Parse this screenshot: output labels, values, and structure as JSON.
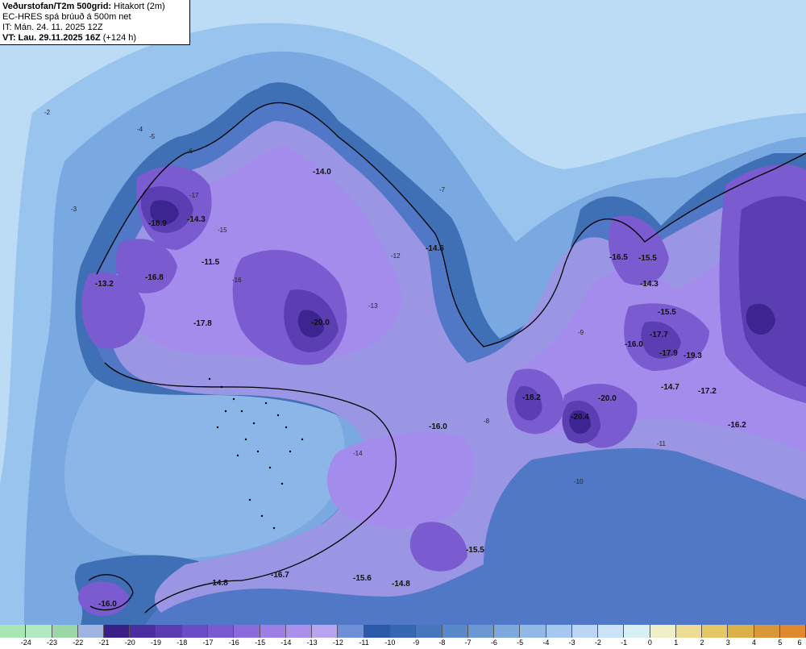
{
  "header": {
    "title": "Veðurstofan/T2m 500grid:",
    "subtitle": "Hitakort (2m)",
    "model_line": "EC-HRES spá brúuð á 500m net",
    "init_time": "IT: Mán. 24. 11. 2025 12Z",
    "valid_time": "VT: Lau. 29.11.2025 16Z",
    "lead": "(+124 h)"
  },
  "colors": {
    "sea_far": "#bcdcf6",
    "sea_mid": "#98c4ee",
    "sea_near": "#7aa8e0",
    "coast_band": "#3f6fb4",
    "coast_dark": "#2a4f8e",
    "land_m10": "#5078c6",
    "land_m12": "#8e96de",
    "land_m14": "#a48cec",
    "land_m16": "#7a5cd0",
    "land_m18": "#5a3eb2",
    "land_m20": "#3c2590"
  },
  "scale": {
    "labels": [
      "-24",
      "-23",
      "-22",
      "-21",
      "-20",
      "-19",
      "-18",
      "-17",
      "-16",
      "-15",
      "-14",
      "-13",
      "-12",
      "-11",
      "-10",
      "-9",
      "-8",
      "-7",
      "-6",
      "-5",
      "-4",
      "-3",
      "-2",
      "-1",
      "0",
      "1",
      "2",
      "3",
      "4",
      "5",
      "6"
    ],
    "colors": [
      "#a8e6b4",
      "#b2e8c2",
      "#9ad6a6",
      "#9fb4e0",
      "#3a1f86",
      "#4c2ea0",
      "#5a3cb0",
      "#6a4cc4",
      "#7a5ad0",
      "#8c6adc",
      "#9c7ee4",
      "#aa90ea",
      "#b8a4f0",
      "#6f8fd6",
      "#2b5aa8",
      "#3668b2",
      "#4676bc",
      "#5a88c8",
      "#6c98d2",
      "#7ea8dc",
      "#92b8e6",
      "#a6c8ee",
      "#bad6f4",
      "#cce2f8",
      "#d8f0f2",
      "#f0f0c8",
      "#ecdc94",
      "#e4c868",
      "#dcb048",
      "#d8983a",
      "#e08a30"
    ]
  },
  "map_labels": [
    {
      "text": "-14.0"
    },
    {
      "text": "-18.9"
    },
    {
      "text": "-14.3"
    },
    {
      "text": "-11.5"
    },
    {
      "text": "-16.8"
    },
    {
      "text": "-13.2"
    },
    {
      "text": "-17.8"
    },
    {
      "text": "-20.0"
    },
    {
      "text": "-14.6"
    },
    {
      "text": "-16.5"
    },
    {
      "text": "-15.5"
    },
    {
      "text": "-14.3"
    },
    {
      "text": "-15.5"
    },
    {
      "text": "-17.7"
    },
    {
      "text": "-16.0"
    },
    {
      "text": "-17.9"
    },
    {
      "text": "-19.3"
    },
    {
      "text": "-18.2"
    },
    {
      "text": "-20.0"
    },
    {
      "text": "-20.4"
    },
    {
      "text": "-14.7"
    },
    {
      "text": "-17.2"
    },
    {
      "text": "-16.2"
    },
    {
      "text": "-16.0"
    },
    {
      "text": "-15.5"
    },
    {
      "text": "-14.8"
    },
    {
      "text": "-16.7"
    },
    {
      "text": "-15.6"
    },
    {
      "text": "-14.8"
    },
    {
      "text": "-16.0"
    }
  ],
  "contour_labels": [
    "-2",
    "-3",
    "-4",
    "-5",
    "-6",
    "-7",
    "-8",
    "-9",
    "-10",
    "-11",
    "-12",
    "-13",
    "-14",
    "-15",
    "-16",
    "-17"
  ]
}
